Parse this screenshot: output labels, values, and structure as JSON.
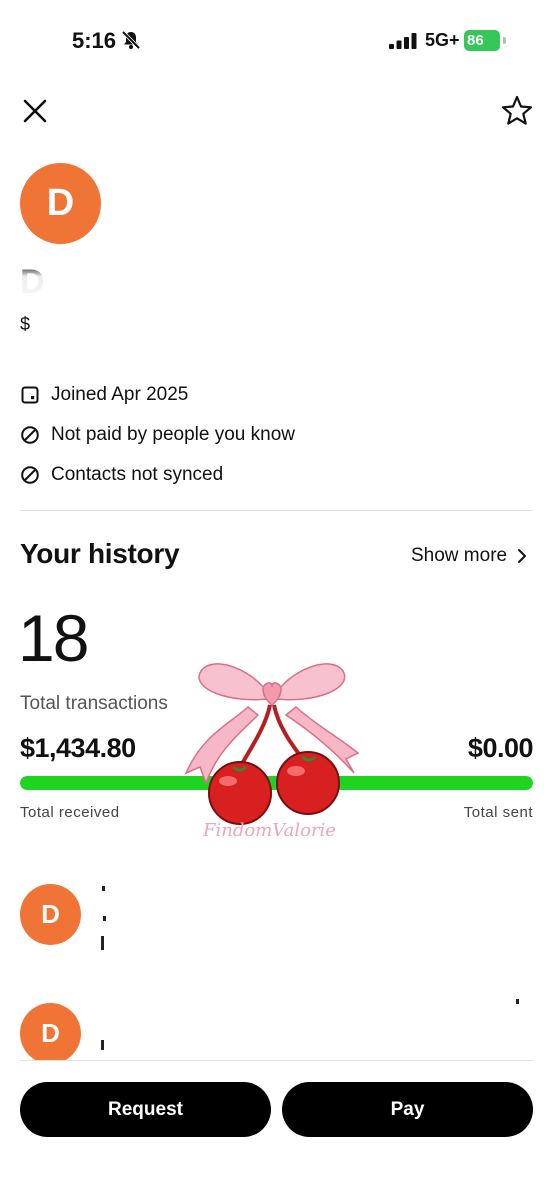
{
  "status_bar": {
    "time": "5:16",
    "network": "5G+",
    "battery": "86",
    "icons": [
      "bell-muted-icon",
      "signal-icon",
      "battery-icon"
    ]
  },
  "header": {
    "icons": [
      "close-icon",
      "star-icon"
    ]
  },
  "profile": {
    "avatar_initial": "D",
    "avatar_color": "#f07436",
    "name_visible": "D",
    "handle_visible": "$",
    "info": [
      {
        "icon": "calendar-icon",
        "text": "Joined Apr 2025"
      },
      {
        "icon": "block-icon",
        "text": "Not paid by people you know"
      },
      {
        "icon": "block-icon",
        "text": "Contacts not synced"
      }
    ]
  },
  "history": {
    "title": "Your history",
    "show_more": "Show more",
    "transactions_count": "18",
    "transactions_label": "Total transactions",
    "total_received": "$1,434.80",
    "total_sent": "$0.00",
    "received_label": "Total received",
    "sent_label": "Total sent",
    "received_fraction": 1.0,
    "bar_color": "#1fd421"
  },
  "watermark": "FindomValorie",
  "transactions": [
    {
      "avatar_initial": "D"
    },
    {
      "avatar_initial": "D"
    }
  ],
  "actions": {
    "request": "Request",
    "pay": "Pay"
  }
}
